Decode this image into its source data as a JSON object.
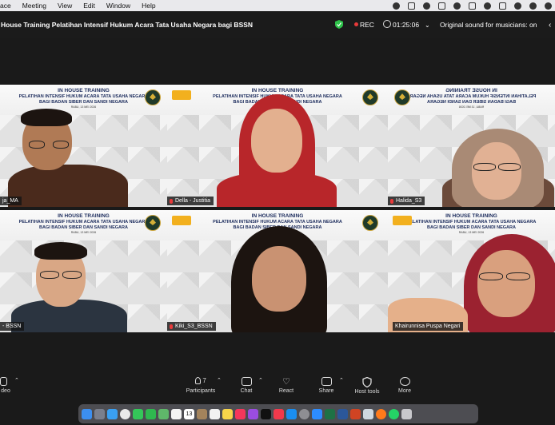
{
  "menubar": {
    "items": [
      "ace",
      "Meeting",
      "View",
      "Edit",
      "Window",
      "Help"
    ]
  },
  "titlebar": {
    "title": "House Training Pelatihan Intensif Hukum Acara Tata Usaha Negara bagi BSSN",
    "rec_label": "REC",
    "timer": "01:25:06",
    "original_sound": "Original sound for musicians: on"
  },
  "banner": {
    "line1": "IN HOUSE TRAINING",
    "line2": "PELATIHAN INTENSIF HUKUM ACARA TATA USAHA NEGARA",
    "line3": "BAGI BADAN SIBER DAN SANDI NEGARA",
    "line4": "RABU, 13 MEI 2026"
  },
  "participants": [
    {
      "name": "ja_MA",
      "active": true,
      "muted": false
    },
    {
      "name": "Della - Justitia",
      "active": false,
      "muted": true
    },
    {
      "name": "Halida_S3",
      "active": false,
      "muted": true
    },
    {
      "name": "- BSSN",
      "active": false,
      "muted": false
    },
    {
      "name": "Kiki_S3_BSSN",
      "active": false,
      "muted": true
    },
    {
      "name": "Khairunnisa Puspa Negari",
      "active": false,
      "muted": false
    }
  ],
  "toolbar": {
    "video": "deo",
    "participants": "Participants",
    "participants_count": "7",
    "chat": "Chat",
    "react": "React",
    "share": "Share",
    "host_tools": "Host tools",
    "more": "More"
  },
  "colors": {
    "active_speaker": "#27c23d",
    "rec": "#e83a3a",
    "banner_text": "#1b2b5c"
  },
  "dock": {
    "app_icons": [
      "finder-icon",
      "launchpad-icon",
      "safari-icon",
      "chrome-icon",
      "messages-icon",
      "facetime-icon",
      "maps-icon",
      "photos-icon",
      "calendar-icon",
      "contacts-icon",
      "reminders-icon",
      "notes-icon",
      "music-icon",
      "podcasts-icon",
      "tv-icon",
      "news-icon",
      "appstore-icon",
      "settings-icon",
      "zoom-icon",
      "excel-icon",
      "word-icon",
      "powerpoint-icon",
      "preview-icon",
      "firefox-icon",
      "whatsapp-icon",
      "trash-icon"
    ],
    "calendar_day": "13"
  }
}
